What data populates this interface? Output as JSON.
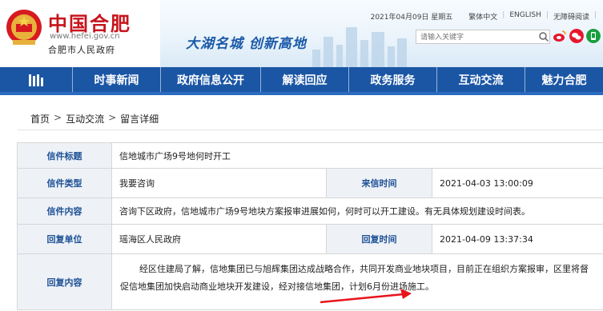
{
  "header": {
    "site_name": "中国合肥",
    "site_url": "www.hefei.gov.cn",
    "org_name": "合肥市人民政府",
    "slogan": "大湖名城  创新高地",
    "date": "2021年04月09日 星期五",
    "links": [
      "繁体中文",
      "ENGLISH",
      "无障碍阅读"
    ],
    "search_placeholder": "请输入关键字",
    "colors": {
      "brand_red": "#c7141c",
      "nav_blue": "#1b56a5",
      "label_blue": "#1b4f94"
    }
  },
  "nav": {
    "items": [
      "时事新闻",
      "政府信息公开",
      "解读回应",
      "政务服务",
      "互动交流",
      "魅力合肥"
    ]
  },
  "breadcrumb": [
    "首页",
    "互动交流",
    "留言详细"
  ],
  "letter": {
    "title_label": "信件标题",
    "title": "信地城市广场9号地何时开工",
    "type_label": "信件类型",
    "type": "我要咨询",
    "date_label": "来信时间",
    "date": "2021-04-03 13:00:09",
    "content_label": "信件内容",
    "content": "咨询下区政府，信地城市广场9号地块方案报审进展如何，何时可以开工建设。有无具体规划建设时间表。",
    "reply_unit_label": "回复单位",
    "reply_unit": "瑶海区人民政府",
    "reply_date_label": "回复时间",
    "reply_date": "2021-04-09 13:37:34",
    "reply_label": "回复内容",
    "reply_text": "经区住建局了解，信地集团已与旭辉集团达成战略合作，共同开发商业地块项目，目前正在组织方案报审，区里将督促信地集团加快启动商业地块开发建设，经对接信地集团，计划6月份进场施工。"
  }
}
